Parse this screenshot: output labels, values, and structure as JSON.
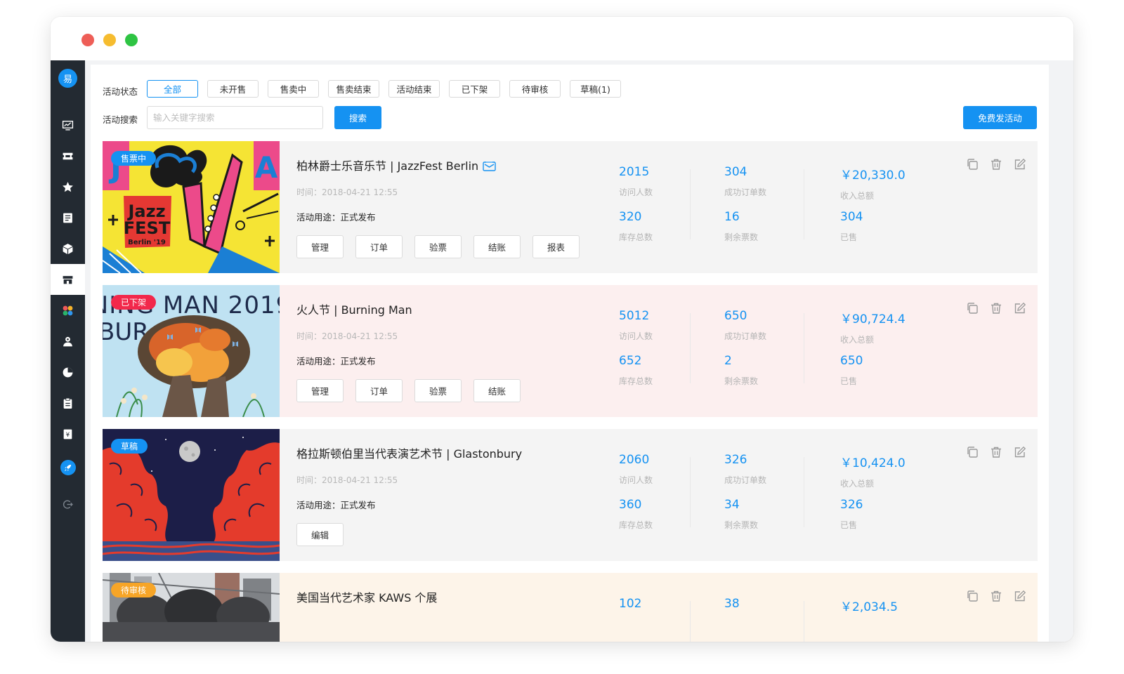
{
  "app": {
    "logo_text": "易"
  },
  "filters": {
    "status_label": "活动状态",
    "search_label": "活动搜索",
    "search_placeholder": "输入关键字搜索",
    "search_button": "搜索",
    "publish_button": "免费发活动",
    "chips": [
      "全部",
      "未开售",
      "售卖中",
      "售卖结束",
      "活动结束",
      "已下架",
      "待审核",
      "草稿(1)"
    ],
    "active_chip": "全部"
  },
  "sidebar": {
    "items": [
      "dashboard-icon",
      "ticket-icon",
      "star-icon",
      "list-icon",
      "cube-icon",
      "store-icon",
      "apps-icon",
      "users-icon",
      "pie-chart-icon",
      "clipboard-icon",
      "finance-icon",
      "rocket-icon",
      "logout-icon"
    ],
    "active": "store-icon"
  },
  "captions": {
    "visitors": "访问人数",
    "orders": "成功订单数",
    "revenue": "收入总额",
    "stock": "库存总数",
    "remaining": "剩余票数",
    "sold": "已售"
  },
  "events": [
    {
      "status": "售票中",
      "status_color": "#1592f2",
      "bg": "#f4f4f4",
      "title": "柏林爵士乐音乐节 | JazzFest Berlin",
      "time": "时间：2018-04-21  12:55",
      "purpose": "活动用途：正式发布",
      "actions": [
        "管理",
        "订单",
        "验票",
        "结账",
        "报表"
      ],
      "visitors": "2015",
      "orders": "304",
      "revenue": "￥20,330.0",
      "stock": "320",
      "remaining": "16",
      "sold": "304"
    },
    {
      "status": "已下架",
      "status_color": "#f2284b",
      "bg": "#fcefef",
      "title": "火人节 | Burning Man",
      "time": "时间：2018-04-21  12:55",
      "purpose": "活动用途：正式发布",
      "actions": [
        "管理",
        "订单",
        "验票",
        "结账"
      ],
      "visitors": "5012",
      "orders": "650",
      "revenue": "￥90,724.4",
      "stock": "652",
      "remaining": "2",
      "sold": "650"
    },
    {
      "status": "草稿",
      "status_color": "#1592f2",
      "bg": "#f4f4f4",
      "title": "格拉斯顿伯里当代表演艺术节 | Glastonbury",
      "time": "时间：2018-04-21  12:55",
      "purpose": "活动用途：正式发布",
      "actions": [
        "编辑"
      ],
      "visitors": "2060",
      "orders": "326",
      "revenue": "￥10,424.0",
      "stock": "360",
      "remaining": "34",
      "sold": "326"
    },
    {
      "status": "待审核",
      "status_color": "#f7a527",
      "bg": "#fdf4e9",
      "title": "美国当代艺术家 KAWS 个展",
      "visitors": "102",
      "orders": "38",
      "revenue": "￥2,034.5"
    }
  ]
}
